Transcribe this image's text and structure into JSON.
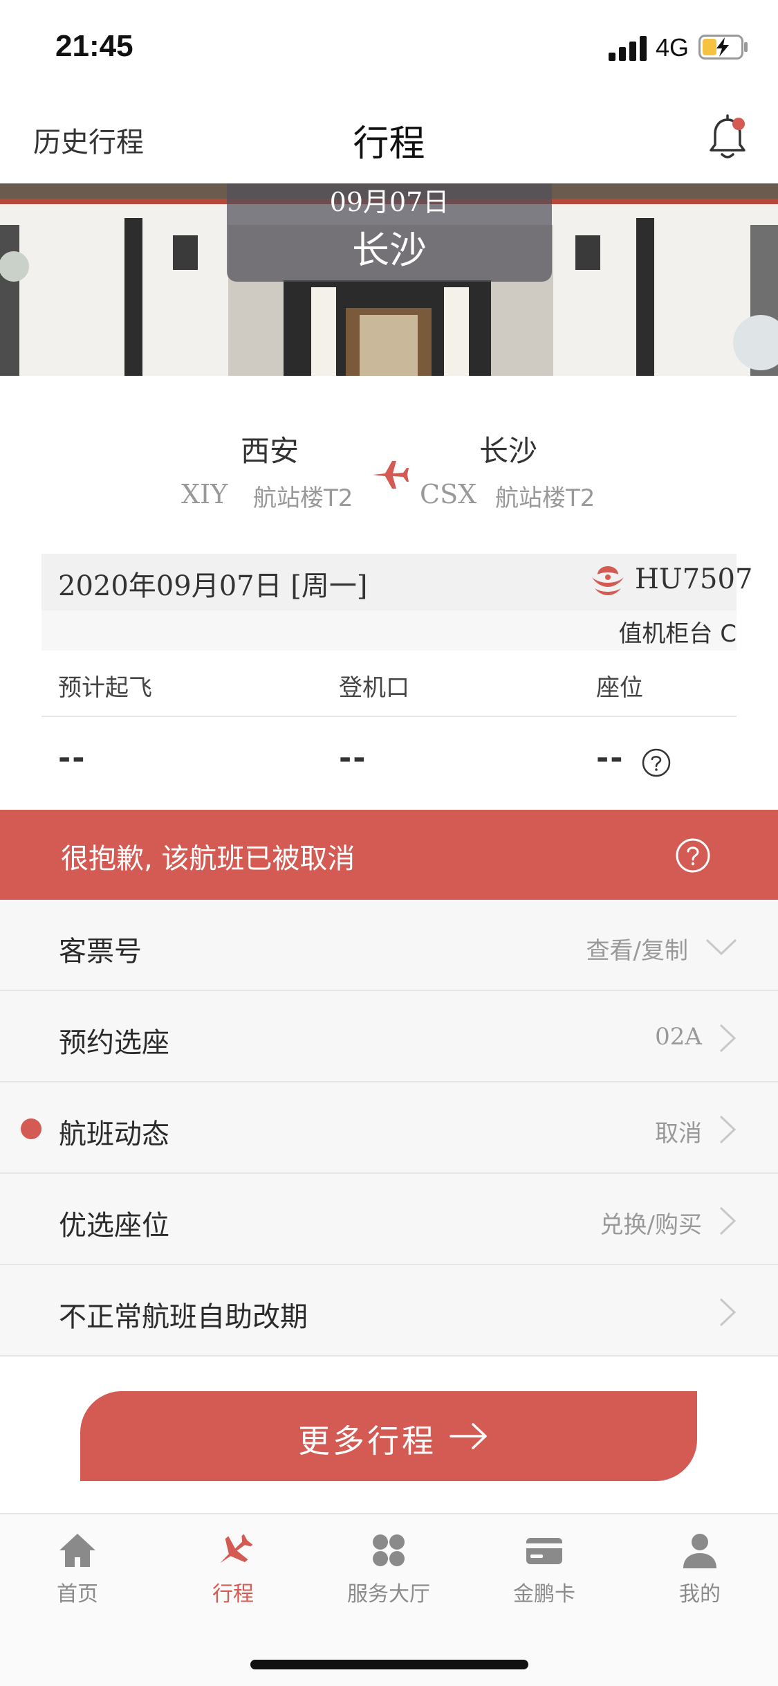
{
  "status_bar": {
    "time": "21:45",
    "network": "4G"
  },
  "nav": {
    "left_label": "历史行程",
    "title": "行程"
  },
  "hero": {
    "date": "09月07日",
    "city": "长沙"
  },
  "route": {
    "departure": {
      "city": "西安",
      "code": "XIY",
      "terminal": "航站楼T2"
    },
    "arrival": {
      "city": "长沙",
      "code": "CSX",
      "terminal": "航站楼T2"
    }
  },
  "flight_info": {
    "date": "2020年09月07日 [周一]",
    "flight_no": "HU7507",
    "counter": "值机柜台  C",
    "columns": [
      "预计起飞",
      "登机口",
      "座位"
    ],
    "values": [
      "--",
      "--",
      "--"
    ]
  },
  "banner": {
    "text": "很抱歉, 该航班已被取消"
  },
  "rows": [
    {
      "label": "客票号",
      "value": "查看/复制"
    },
    {
      "label": "预约选座",
      "value": "02A"
    },
    {
      "label": "航班动态",
      "value": "取消"
    },
    {
      "label": "优选座位",
      "value": "兑换/购买"
    },
    {
      "label": "不正常航班自助改期",
      "value": ""
    }
  ],
  "more_button": {
    "label": "更多行程"
  },
  "tabs": [
    {
      "label": "首页"
    },
    {
      "label": "行程"
    },
    {
      "label": "服务大厅"
    },
    {
      "label": "金鹏卡"
    },
    {
      "label": "我的"
    }
  ],
  "colors": {
    "accent": "#d45b53",
    "text": "#2b2b2b",
    "muted": "#999999",
    "list_bg": "#f7f7f7"
  }
}
